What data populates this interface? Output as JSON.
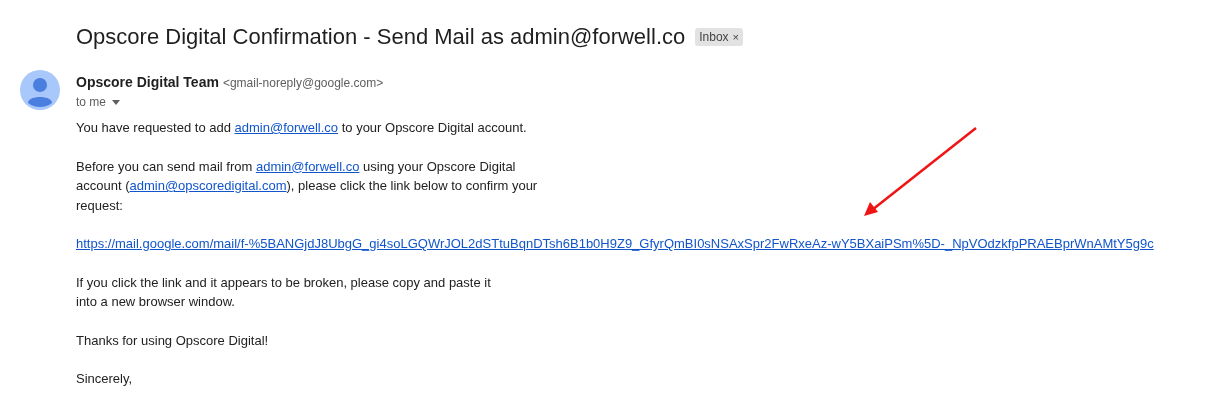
{
  "subject": "Opscore Digital Confirmation - Send Mail as admin@forwell.co",
  "label": {
    "text": "Inbox",
    "remove": "×"
  },
  "sender": {
    "name": "Opscore Digital Team",
    "address": "<gmail-noreply@google.com>",
    "recipient": "to me"
  },
  "paragraphs": [
    {
      "lines": [
        [
          {
            "kind": "text",
            "text": "You have requested to add "
          },
          {
            "kind": "link",
            "text": "admin@forwell.co"
          },
          {
            "kind": "text",
            "text": " to your Opscore Digital account."
          }
        ]
      ]
    },
    {
      "lines": [
        [
          {
            "kind": "text",
            "text": "Before you can send mail from "
          },
          {
            "kind": "link",
            "text": "admin@forwell.co"
          },
          {
            "kind": "text",
            "text": " using your Opscore Digital"
          }
        ],
        [
          {
            "kind": "text",
            "text": "account ("
          },
          {
            "kind": "link",
            "text": "admin@opscoredigital.com"
          },
          {
            "kind": "text",
            "text": "), please click the link below to confirm your"
          }
        ],
        [
          {
            "kind": "text",
            "text": "request:"
          }
        ]
      ]
    },
    {
      "lines": [
        [
          {
            "kind": "link",
            "text": "https://mail.google.com/mail/f-%5BANGjdJ8UbgG_gi4soLGQWrJOL2dSTtuBqnDTsh6B1b0H9Z9_GfyrQmBI0sNSAxSpr2FwRxeAz-wY5BXaiPSm%5D-_NpVOdzkfpPRAEBprWnAMtY5g9c"
          }
        ]
      ]
    },
    {
      "lines": [
        [
          {
            "kind": "text",
            "text": "If you click the link and it appears to be broken, please copy and paste it"
          }
        ],
        [
          {
            "kind": "text",
            "text": "into a new browser window."
          }
        ]
      ]
    },
    {
      "lines": [
        [
          {
            "kind": "text",
            "text": "Thanks for using Opscore Digital!"
          }
        ]
      ]
    },
    {
      "lines": [
        [
          {
            "kind": "text",
            "text": "Sincerely,"
          }
        ]
      ]
    }
  ]
}
